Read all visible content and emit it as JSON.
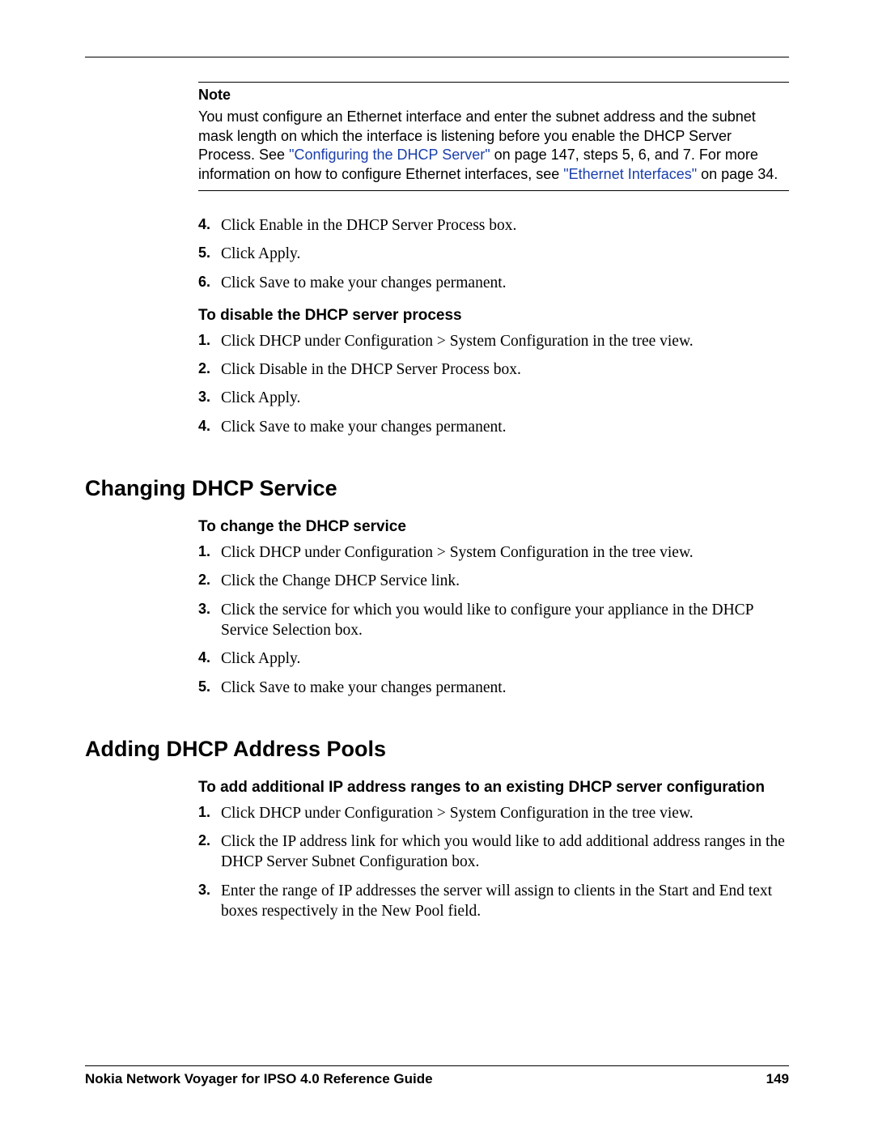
{
  "note": {
    "header": "Note",
    "text_before_link1": "You must configure an Ethernet interface and enter the subnet address and the subnet mask length on which the interface is listening before you enable the DHCP Server Process. See ",
    "link1": "\"Configuring the DHCP Server\"",
    "text_between": " on page 147, steps 5, 6, and 7. For more information on how to configure Ethernet interfaces, see ",
    "link2": "\"Ethernet Interfaces\"",
    "text_after": " on page 34."
  },
  "steps_first": [
    {
      "n": "4.",
      "t": "Click Enable in the DHCP Server Process box."
    },
    {
      "n": "5.",
      "t": "Click Apply."
    },
    {
      "n": "6.",
      "t": "Click Save to make your changes permanent."
    }
  ],
  "sub_disable": "To disable the DHCP server process",
  "steps_disable": [
    {
      "n": "1.",
      "t": "Click DHCP under Configuration > System Configuration in the tree view."
    },
    {
      "n": "2.",
      "t": "Click Disable in the DHCP Server Process box."
    },
    {
      "n": "3.",
      "t": "Click Apply."
    },
    {
      "n": "4.",
      "t": "Click Save to make your changes permanent."
    }
  ],
  "h2_changing": "Changing DHCP Service",
  "sub_change": "To change the DHCP service",
  "steps_change": [
    {
      "n": "1.",
      "t": "Click DHCP under Configuration > System Configuration in the tree view."
    },
    {
      "n": "2.",
      "t": "Click the Change DHCP Service link."
    },
    {
      "n": "3.",
      "t": "Click the service for which you would like to configure your appliance in the DHCP Service Selection box."
    },
    {
      "n": "4.",
      "t": "Click Apply."
    },
    {
      "n": "5.",
      "t": "Click Save to make your changes permanent."
    }
  ],
  "h2_adding": "Adding DHCP Address Pools",
  "sub_add": "To add additional IP address ranges to an existing DHCP server configuration",
  "steps_add": [
    {
      "n": "1.",
      "t": "Click DHCP under Configuration > System Configuration in the tree view."
    },
    {
      "n": "2.",
      "t": "Click the IP address link for which you would like to add additional address ranges in the DHCP Server Subnet Configuration box."
    },
    {
      "n": "3.",
      "t": "Enter the range of IP addresses the server will assign to clients in the Start and End text boxes respectively in the New Pool field."
    }
  ],
  "footer": {
    "title": "Nokia Network Voyager for IPSO 4.0 Reference Guide",
    "page": "149"
  }
}
